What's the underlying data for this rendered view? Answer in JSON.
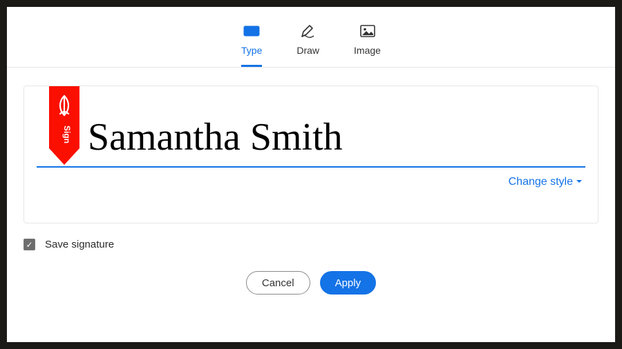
{
  "tabs": {
    "type": "Type",
    "draw": "Draw",
    "image": "Image"
  },
  "active_tab": "type",
  "signature": {
    "value": "Samantha Smith",
    "change_style_label": "Change style"
  },
  "bookmark": {
    "text": "Sign"
  },
  "save": {
    "label": "Save signature",
    "checked": true
  },
  "buttons": {
    "cancel": "Cancel",
    "apply": "Apply"
  },
  "colors": {
    "accent": "#1473e6",
    "bookmark": "#fa0f00"
  }
}
